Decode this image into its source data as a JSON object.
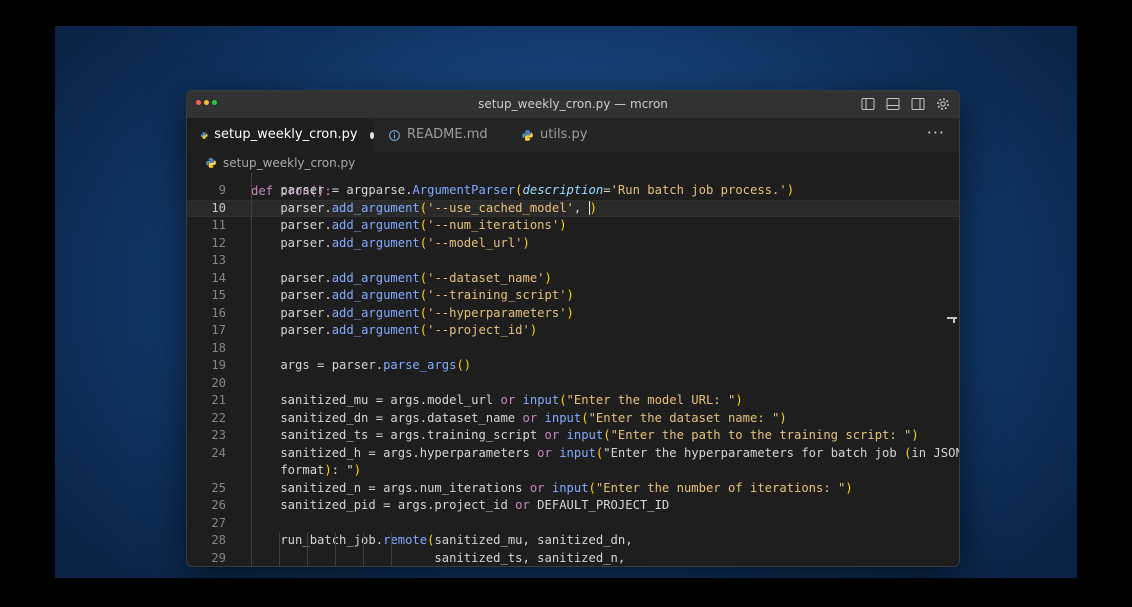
{
  "window": {
    "title": "setup_weekly_cron.py — mcron",
    "traffic_lights": [
      "#ff5f57",
      "#febc2e",
      "#28c840"
    ]
  },
  "tabs": [
    {
      "label": "setup_weekly_cron.py",
      "icon": "python-icon",
      "active": true,
      "modified": true
    },
    {
      "label": "README.md",
      "icon": "info-icon",
      "active": false
    },
    {
      "label": "utils.py",
      "icon": "python-icon",
      "active": false
    }
  ],
  "more_label": "···",
  "breadcrumb": {
    "file": "setup_weekly_cron.py"
  },
  "editor": {
    "partial_top": "def cron():",
    "lines": [
      {
        "n": "9",
        "text": "    parser = argparse.ArgumentParser(description='Run batch job process.')"
      },
      {
        "n": "10",
        "text": "    parser.add_argument('--use_cached_model', )"
      },
      {
        "n": "11",
        "text": "    parser.add_argument('--num_iterations')"
      },
      {
        "n": "12",
        "text": "    parser.add_argument('--model_url')"
      },
      {
        "n": "13",
        "text": ""
      },
      {
        "n": "14",
        "text": "    parser.add_argument('--dataset_name')"
      },
      {
        "n": "15",
        "text": "    parser.add_argument('--training_script')"
      },
      {
        "n": "16",
        "text": "    parser.add_argument('--hyperparameters')"
      },
      {
        "n": "17",
        "text": "    parser.add_argument('--project_id')"
      },
      {
        "n": "18",
        "text": ""
      },
      {
        "n": "19",
        "text": "    args = parser.parse_args()"
      },
      {
        "n": "20",
        "text": ""
      },
      {
        "n": "21",
        "text": "    sanitized_mu = args.model_url or input(\"Enter the model URL: \")"
      },
      {
        "n": "22",
        "text": "    sanitized_dn = args.dataset_name or input(\"Enter the dataset name: \")"
      },
      {
        "n": "23",
        "text": "    sanitized_ts = args.training_script or input(\"Enter the path to the training script: \")"
      },
      {
        "n": "24",
        "text": "    sanitized_h = args.hyperparameters or input(\"Enter the hyperparameters for batch job (in JSON"
      },
      {
        "n": "",
        "text": "    format): \")"
      },
      {
        "n": "25",
        "text": "    sanitized_n = args.num_iterations or input(\"Enter the number of iterations: \")"
      },
      {
        "n": "26",
        "text": "    sanitized_pid = args.project_id or DEFAULT_PROJECT_ID"
      },
      {
        "n": "27",
        "text": ""
      },
      {
        "n": "28",
        "text": "    run_batch_job.remote(sanitized_mu, sanitized_dn,"
      },
      {
        "n": "29",
        "text": "                         sanitized_ts, sanitized_n,"
      }
    ],
    "current_line": "10"
  }
}
